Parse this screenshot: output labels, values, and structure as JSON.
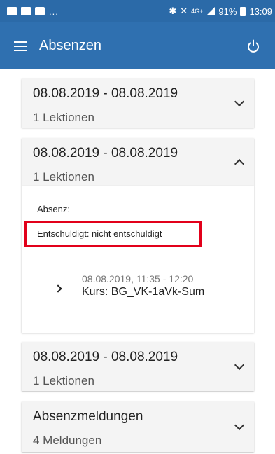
{
  "status_bar": {
    "left_dots": "...",
    "network": "4G+",
    "battery": "91%",
    "time": "13:09"
  },
  "app_bar": {
    "title": "Absenzen"
  },
  "absences": [
    {
      "date_range": "08.08.2019 - 08.08.2019",
      "lessons": "1 Lektionen",
      "expanded": false
    },
    {
      "date_range": "08.08.2019 - 08.08.2019",
      "lessons": "1 Lektionen",
      "expanded": true,
      "detail": {
        "absenz_label": "Absenz:",
        "entschuldigt": "Entschuldigt: nicht entschuldigt",
        "lesson_time": "08.08.2019, 11:35 - 12:20",
        "kurs": "Kurs: BG_VK-1aVk-Sum"
      }
    },
    {
      "date_range": "08.08.2019 - 08.08.2019",
      "lessons": "1 Lektionen",
      "expanded": false
    }
  ],
  "meldungen": {
    "title": "Absenzmeldungen",
    "count": "4 Meldungen"
  },
  "colors": {
    "status_bar": "#2b6aa8",
    "app_bar": "#2f70b0",
    "highlight_border": "#e2001a"
  }
}
